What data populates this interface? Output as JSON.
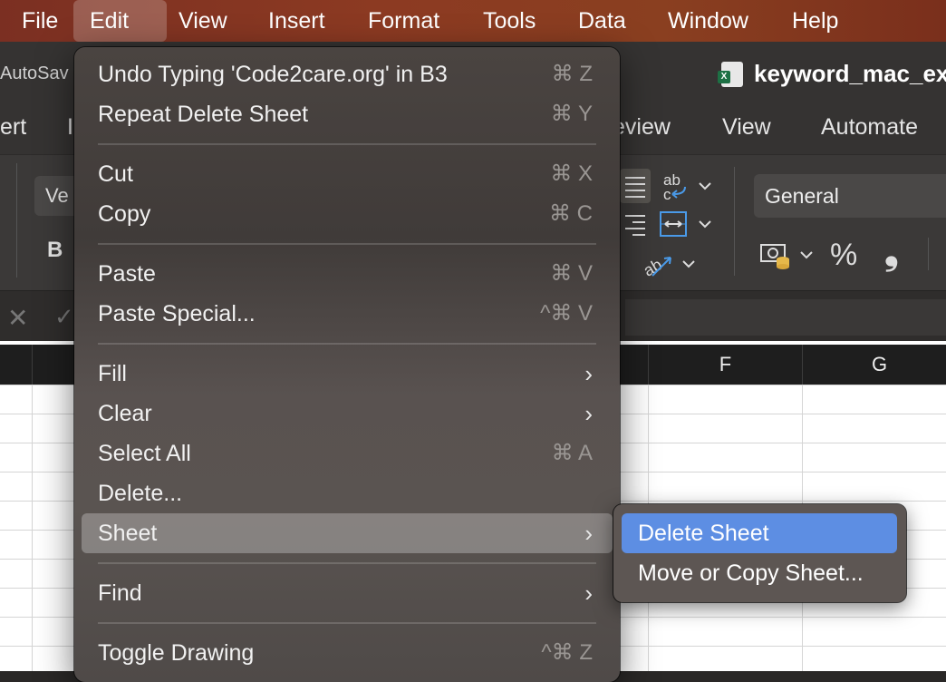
{
  "menubar": {
    "items": [
      "File",
      "Edit",
      "View",
      "Insert",
      "Format",
      "Tools",
      "Data",
      "Window",
      "Help"
    ],
    "active": "Edit"
  },
  "titlebar": {
    "autosave": "AutoSav",
    "doc_title": "keyword_mac_ex",
    "file_icon_badge": "X"
  },
  "ribbon": {
    "tabs": [
      "ert",
      "I",
      "eview",
      "View",
      "Automate"
    ],
    "font_name": "Ve",
    "bold_label": "B",
    "number_format": "General",
    "percent_label": "%",
    "comma_label": "❟"
  },
  "sheet": {
    "columns": [
      "F",
      "G"
    ]
  },
  "edit_menu": {
    "items": [
      {
        "label": "Undo Typing 'Code2care.org' in B3",
        "shortcut": "⌘ Z"
      },
      {
        "label": "Repeat Delete Sheet",
        "shortcut": "⌘ Y"
      },
      {
        "label": "Cut",
        "shortcut": "⌘ X"
      },
      {
        "label": "Copy",
        "shortcut": "⌘ C"
      },
      {
        "label": "Paste",
        "shortcut": "⌘ V"
      },
      {
        "label": "Paste Special...",
        "shortcut": "^⌘ V"
      },
      {
        "label": "Fill",
        "submenu": true
      },
      {
        "label": "Clear",
        "submenu": true
      },
      {
        "label": "Select All",
        "shortcut": "⌘ A"
      },
      {
        "label": "Delete..."
      },
      {
        "label": "Sheet",
        "submenu": true,
        "highlighted": true
      },
      {
        "label": "Find",
        "submenu": true
      },
      {
        "label": "Toggle Drawing",
        "shortcut": "^⌘ Z"
      }
    ]
  },
  "sheet_submenu": {
    "items": [
      {
        "label": "Delete Sheet",
        "highlighted": true
      },
      {
        "label": "Move or Copy Sheet..."
      }
    ]
  },
  "colors": {
    "menubar": "#8a3a22",
    "highlight_blue": "#5d8ee3"
  }
}
